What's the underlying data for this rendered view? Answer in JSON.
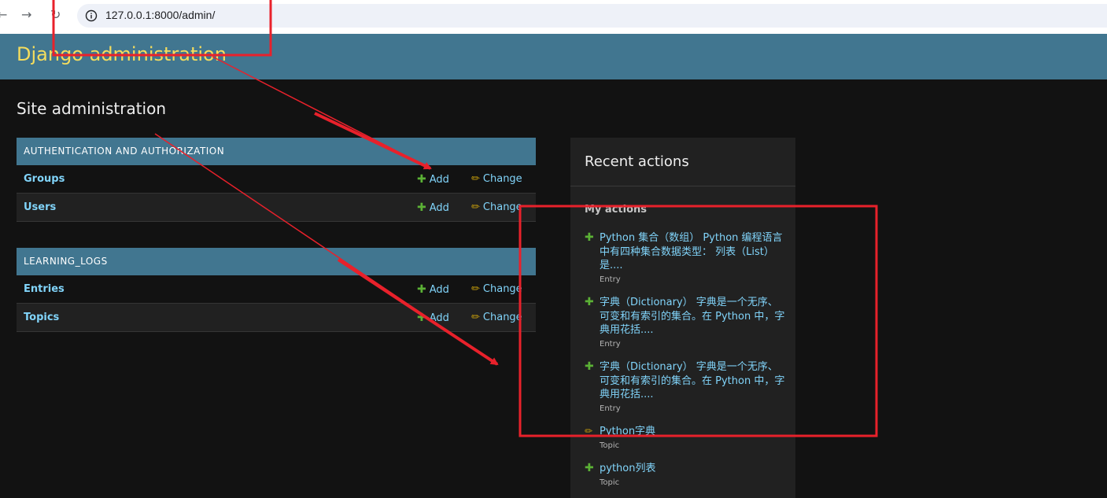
{
  "browser": {
    "back_icon": "back-arrow-icon",
    "forward_icon": "forward-arrow-icon",
    "reload_icon": "reload-icon",
    "url": "127.0.0.1:8000/admin/"
  },
  "header": {
    "branding": "Django administration"
  },
  "page": {
    "title": "Site administration"
  },
  "modules": [
    {
      "caption": "AUTHENTICATION AND AUTHORIZATION",
      "models": [
        {
          "name": "Groups",
          "add": "Add",
          "change": "Change"
        },
        {
          "name": "Users",
          "add": "Add",
          "change": "Change"
        }
      ]
    },
    {
      "caption": "LEARNING_LOGS",
      "models": [
        {
          "name": "Entries",
          "add": "Add",
          "change": "Change"
        },
        {
          "name": "Topics",
          "add": "Add",
          "change": "Change"
        }
      ]
    }
  ],
  "recent_actions": {
    "title": "Recent actions",
    "subtitle": "My actions",
    "items": [
      {
        "icon": "add",
        "text": "Python 集合（数组） Python 编程语言中有四种集合数据类型： 列表（List）是....",
        "type": "Entry"
      },
      {
        "icon": "add",
        "text": "字典（Dictionary） 字典是一个无序、可变和有索引的集合。在 Python 中，字典用花括....",
        "type": "Entry"
      },
      {
        "icon": "add",
        "text": "字典（Dictionary） 字典是一个无序、可变和有索引的集合。在 Python 中，字典用花括....",
        "type": "Entry"
      },
      {
        "icon": "change",
        "text": "Python字典",
        "type": "Topic"
      },
      {
        "icon": "add",
        "text": "python列表",
        "type": "Topic"
      }
    ]
  },
  "colors": {
    "header_bg": "#417690",
    "branding": "#f5dd5d",
    "link": "#81d4fa",
    "add_icon": "#5bb135",
    "change_icon": "#c49c0b",
    "annotation": "#e8212b"
  }
}
